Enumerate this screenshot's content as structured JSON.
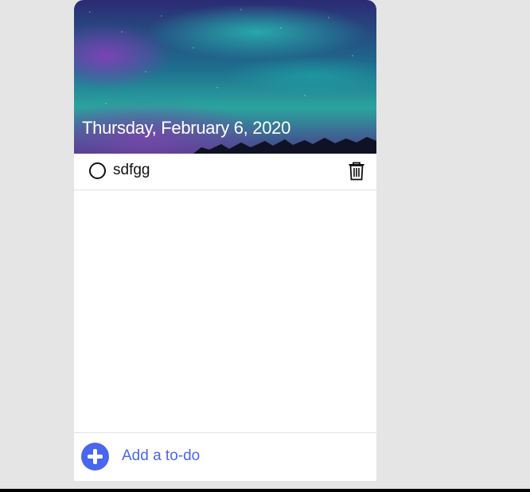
{
  "header": {
    "date": "Thursday, February 6, 2020"
  },
  "todos": [
    {
      "text": "sdfgg",
      "done": false
    }
  ],
  "footer": {
    "add_label": "Add a to-do"
  },
  "colors": {
    "accent": "#4a66ee",
    "background": "#e5e5e5"
  },
  "icons": {
    "status": "circle-icon",
    "delete": "trash-icon",
    "add": "plus-circle-icon"
  }
}
